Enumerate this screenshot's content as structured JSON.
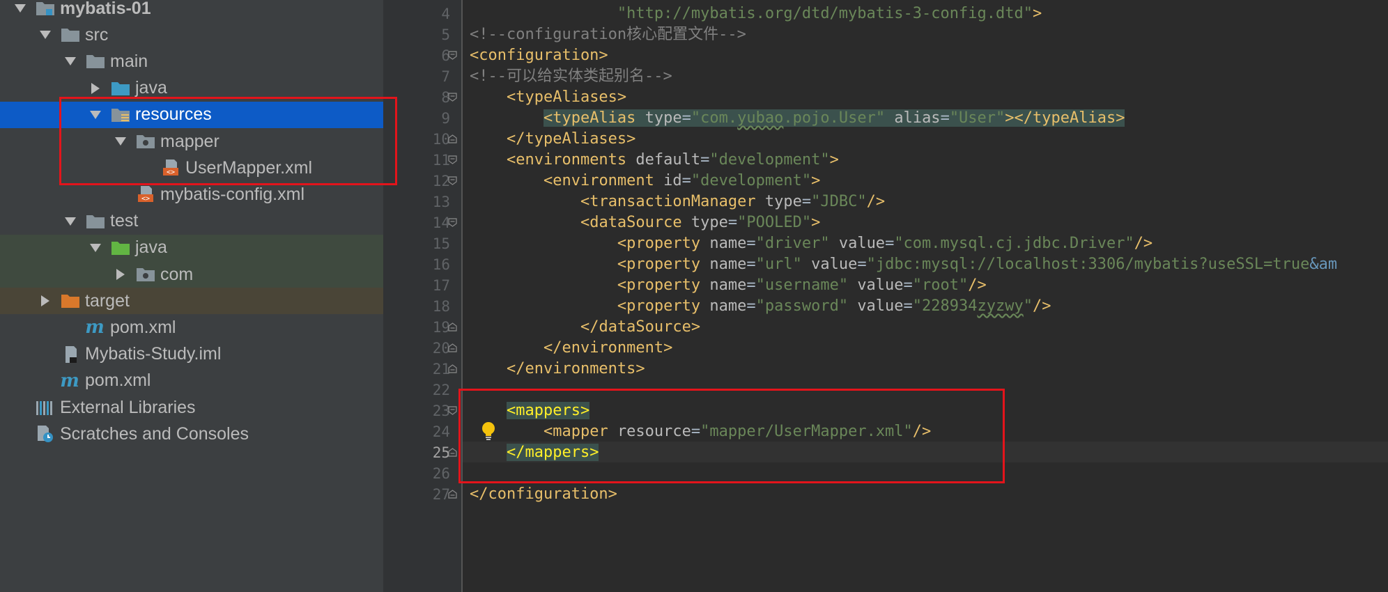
{
  "project": {
    "rows": [
      {
        "label": "mybatis-01",
        "icon": "module-folder-icon",
        "arrow": "expanded",
        "indent": 0,
        "bold": true
      },
      {
        "label": "src",
        "icon": "folder-icon",
        "arrow": "expanded",
        "indent": 1
      },
      {
        "label": "main",
        "icon": "folder-icon",
        "arrow": "expanded",
        "indent": 2
      },
      {
        "label": "java",
        "icon": "source-folder-icon",
        "arrow": "collapsed",
        "indent": 3
      },
      {
        "label": "resources",
        "icon": "resources-folder-icon",
        "arrow": "expanded",
        "indent": 3,
        "selected": true
      },
      {
        "label": "mapper",
        "icon": "package-folder-icon",
        "arrow": "expanded",
        "indent": 4
      },
      {
        "label": "UserMapper.xml",
        "icon": "xml-file-icon",
        "arrow": "none",
        "indent": 5
      },
      {
        "label": "mybatis-config.xml",
        "icon": "xml-file-icon",
        "arrow": "none",
        "indent": 4
      },
      {
        "label": "test",
        "icon": "folder-icon",
        "arrow": "expanded",
        "indent": 2
      },
      {
        "label": "java",
        "icon": "test-folder-icon",
        "arrow": "expanded",
        "indent": 3,
        "tint": "green"
      },
      {
        "label": "com",
        "icon": "package-folder-icon",
        "arrow": "collapsed",
        "indent": 4,
        "tint": "green"
      },
      {
        "label": "target",
        "icon": "excluded-folder-icon",
        "arrow": "collapsed",
        "indent": 1,
        "tint": "brown"
      },
      {
        "label": "pom.xml",
        "icon": "maven-icon",
        "arrow": "none",
        "indent": 2
      },
      {
        "label": "Mybatis-Study.iml",
        "icon": "iml-file-icon",
        "arrow": "none",
        "indent": 1
      },
      {
        "label": "pom.xml",
        "icon": "maven-icon",
        "arrow": "none",
        "indent": 1
      },
      {
        "label": "External Libraries",
        "icon": "libraries-icon",
        "arrow": "none",
        "indent": 0
      },
      {
        "label": "Scratches and Consoles",
        "icon": "scratches-icon",
        "arrow": "none",
        "indent": 0
      }
    ]
  },
  "editor": {
    "current_line": "25",
    "lines": [
      {
        "n": "4",
        "fold": "",
        "indent": 8,
        "tokens": [
          [
            "v",
            "\"http://mybatis.org/dtd/mybatis-3-config.dtd\""
          ],
          [
            "t",
            ">"
          ]
        ]
      },
      {
        "n": "5",
        "fold": "",
        "indent": 0,
        "tokens": [
          [
            "c",
            "<!--configuration核心配置文件-->"
          ]
        ]
      },
      {
        "n": "6",
        "fold": "open",
        "indent": 0,
        "tokens": [
          [
            "t",
            "<configuration>"
          ]
        ]
      },
      {
        "n": "7",
        "fold": "",
        "indent": 0,
        "tokens": [
          [
            "c",
            "<!--可以给实体类起别名-->"
          ]
        ]
      },
      {
        "n": "8",
        "fold": "open",
        "indent": 2,
        "tokens": [
          [
            "t",
            "<typeAliases>"
          ]
        ]
      },
      {
        "n": "9",
        "fold": "",
        "indent": 4,
        "hl": true,
        "tokens": [
          [
            "t",
            "<typeAlias "
          ],
          [
            "a",
            "type"
          ],
          [
            "p",
            "="
          ],
          [
            "v",
            "\"com."
          ],
          [
            "vw",
            "yubao"
          ],
          [
            "v",
            ".pojo.User\" "
          ],
          [
            "a",
            "alias"
          ],
          [
            "p",
            "="
          ],
          [
            "v",
            "\"User\""
          ],
          [
            "t",
            "></typeAlias>"
          ]
        ]
      },
      {
        "n": "10",
        "fold": "close",
        "indent": 2,
        "tokens": [
          [
            "t",
            "</typeAliases>"
          ]
        ]
      },
      {
        "n": "11",
        "fold": "open",
        "indent": 2,
        "tokens": [
          [
            "t",
            "<environments "
          ],
          [
            "a",
            "default"
          ],
          [
            "p",
            "="
          ],
          [
            "v",
            "\"development\""
          ],
          [
            "t",
            ">"
          ]
        ]
      },
      {
        "n": "12",
        "fold": "open",
        "indent": 4,
        "tokens": [
          [
            "t",
            "<environment "
          ],
          [
            "a",
            "id"
          ],
          [
            "p",
            "="
          ],
          [
            "v",
            "\"development\""
          ],
          [
            "t",
            ">"
          ]
        ]
      },
      {
        "n": "13",
        "fold": "",
        "indent": 6,
        "tokens": [
          [
            "t",
            "<transactionManager "
          ],
          [
            "a",
            "type"
          ],
          [
            "p",
            "="
          ],
          [
            "v",
            "\"JDBC\""
          ],
          [
            "t",
            "/>"
          ]
        ]
      },
      {
        "n": "14",
        "fold": "open",
        "indent": 6,
        "tokens": [
          [
            "t",
            "<dataSource "
          ],
          [
            "a",
            "type"
          ],
          [
            "p",
            "="
          ],
          [
            "v",
            "\"POOLED\""
          ],
          [
            "t",
            ">"
          ]
        ]
      },
      {
        "n": "15",
        "fold": "",
        "indent": 8,
        "tokens": [
          [
            "t",
            "<property "
          ],
          [
            "a",
            "name"
          ],
          [
            "p",
            "="
          ],
          [
            "v",
            "\"driver\" "
          ],
          [
            "a",
            "value"
          ],
          [
            "p",
            "="
          ],
          [
            "v",
            "\"com.mysql.cj.jdbc.Driver\""
          ],
          [
            "t",
            "/>"
          ]
        ]
      },
      {
        "n": "16",
        "fold": "",
        "indent": 8,
        "tokens": [
          [
            "t",
            "<property "
          ],
          [
            "a",
            "name"
          ],
          [
            "p",
            "="
          ],
          [
            "v",
            "\"url\" "
          ],
          [
            "a",
            "value"
          ],
          [
            "p",
            "="
          ],
          [
            "v",
            "\"jdbc:mysql://localhost:3306/mybatis?useSSL=true"
          ],
          [
            "e",
            "&am"
          ]
        ]
      },
      {
        "n": "17",
        "fold": "",
        "indent": 8,
        "tokens": [
          [
            "t",
            "<property "
          ],
          [
            "a",
            "name"
          ],
          [
            "p",
            "="
          ],
          [
            "v",
            "\"username\" "
          ],
          [
            "a",
            "value"
          ],
          [
            "p",
            "="
          ],
          [
            "v",
            "\"root\""
          ],
          [
            "t",
            "/>"
          ]
        ]
      },
      {
        "n": "18",
        "fold": "",
        "indent": 8,
        "tokens": [
          [
            "t",
            "<property "
          ],
          [
            "a",
            "name"
          ],
          [
            "p",
            "="
          ],
          [
            "v",
            "\"password\" "
          ],
          [
            "a",
            "value"
          ],
          [
            "p",
            "="
          ],
          [
            "v",
            "\"228934"
          ],
          [
            "vw",
            "zyzwy"
          ],
          [
            "v",
            "\""
          ],
          [
            "t",
            "/>"
          ]
        ]
      },
      {
        "n": "19",
        "fold": "close",
        "indent": 6,
        "tokens": [
          [
            "t",
            "</dataSource>"
          ]
        ]
      },
      {
        "n": "20",
        "fold": "close",
        "indent": 4,
        "tokens": [
          [
            "t",
            "</environment>"
          ]
        ]
      },
      {
        "n": "21",
        "fold": "close",
        "indent": 2,
        "tokens": [
          [
            "t",
            "</environments>"
          ]
        ]
      },
      {
        "n": "22",
        "fold": "",
        "indent": 0,
        "tokens": []
      },
      {
        "n": "23",
        "fold": "open",
        "indent": 2,
        "tokens": [
          [
            "thl",
            "<mappers>"
          ]
        ]
      },
      {
        "n": "24",
        "fold": "",
        "indent": 4,
        "tokens": [
          [
            "t",
            "<mapper "
          ],
          [
            "a",
            "resource"
          ],
          [
            "p",
            "="
          ],
          [
            "v",
            "\"mapper/UserMapper.xml\""
          ],
          [
            "t",
            "/>"
          ]
        ]
      },
      {
        "n": "25",
        "fold": "close",
        "indent": 2,
        "tokens": [
          [
            "thl",
            "</mappers>"
          ]
        ]
      },
      {
        "n": "26",
        "fold": "",
        "indent": 0,
        "tokens": []
      },
      {
        "n": "27",
        "fold": "close",
        "indent": 0,
        "tokens": [
          [
            "t",
            "</configuration>"
          ]
        ]
      }
    ]
  },
  "colors": {
    "accent_selection": "#0d5bc6",
    "annotation_red": "#e3141b",
    "tag": "#e8bf6a",
    "string": "#6a8759",
    "comment": "#808080"
  }
}
